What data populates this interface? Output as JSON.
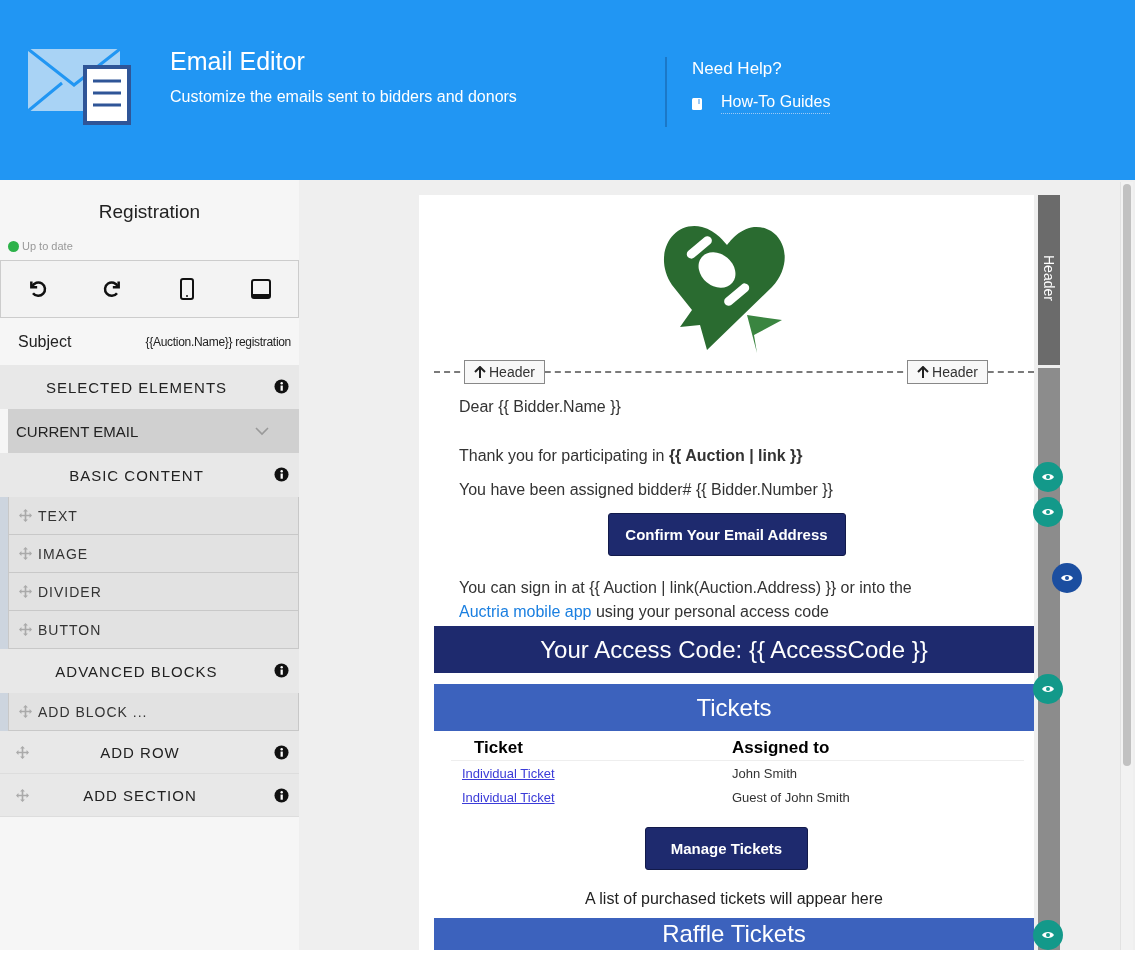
{
  "header": {
    "title": "Email Editor",
    "subtitle": "Customize the emails sent to bidders and donors",
    "help_title": "Need Help?",
    "help_link": "How-To Guides"
  },
  "sidebar": {
    "title": "Registration",
    "status": {
      "text": "Up to date",
      "color": "#2db24a"
    },
    "subject": {
      "label": "Subject",
      "value": "{{Auction.Name}} registration"
    },
    "sections": [
      {
        "kind": "heading",
        "label": "SELECTED ELEMENTS"
      },
      {
        "kind": "dropdown",
        "label": "CURRENT EMAIL",
        "expanded": false
      },
      {
        "kind": "heading",
        "label": "BASIC CONTENT"
      },
      {
        "kind": "item",
        "label": "TEXT"
      },
      {
        "kind": "item",
        "label": "IMAGE"
      },
      {
        "kind": "item",
        "label": "DIVIDER"
      },
      {
        "kind": "item",
        "label": "BUTTON"
      },
      {
        "kind": "heading",
        "label": "ADVANCED BLOCKS"
      },
      {
        "kind": "item",
        "label": "ADD BLOCK ..."
      },
      {
        "kind": "action",
        "label": "ADD ROW"
      },
      {
        "kind": "action",
        "label": "ADD SECTION"
      }
    ]
  },
  "email": {
    "rail_label": "Header",
    "header_buttons": [
      "Header",
      "Header"
    ],
    "blocks": [
      {
        "kind": "text",
        "text": "Dear {{ Bidder.Name }}"
      },
      {
        "kind": "text",
        "text": "Thank you for participating in **{{ Auction | link }}**"
      },
      {
        "kind": "text",
        "text": "You have been assigned bidder# {{ Bidder.Number }}"
      },
      {
        "kind": "button",
        "text": "Confirm Your Email Address"
      },
      {
        "kind": "linktext",
        "before": "You can sign in at {{ Auction | link(Auction.Address) }} or into the",
        "link": "Auctria mobile app",
        "after": "using your personal access code"
      },
      {
        "kind": "banner",
        "text": "Your Access Code: {{ AccessCode }}",
        "color": "#1e2a6e"
      },
      {
        "kind": "banner",
        "text": "Tickets",
        "color": "#3c62bd"
      },
      {
        "kind": "table",
        "columns": [
          "Ticket",
          "Assigned to"
        ],
        "rows": [
          [
            "Individual Ticket",
            "John Smith"
          ],
          [
            "Individual Ticket",
            "Guest of John Smith"
          ]
        ]
      },
      {
        "kind": "button",
        "text": "Manage Tickets"
      },
      {
        "kind": "caption",
        "text": "A list of purchased tickets will appear here"
      },
      {
        "kind": "banner",
        "text": "Raffle Tickets",
        "color": "#3c62bd"
      }
    ]
  },
  "eye_toggles": [
    {
      "selected": false
    },
    {
      "selected": false
    },
    {
      "selected": true
    },
    {
      "selected": false
    },
    {
      "selected": false
    }
  ]
}
